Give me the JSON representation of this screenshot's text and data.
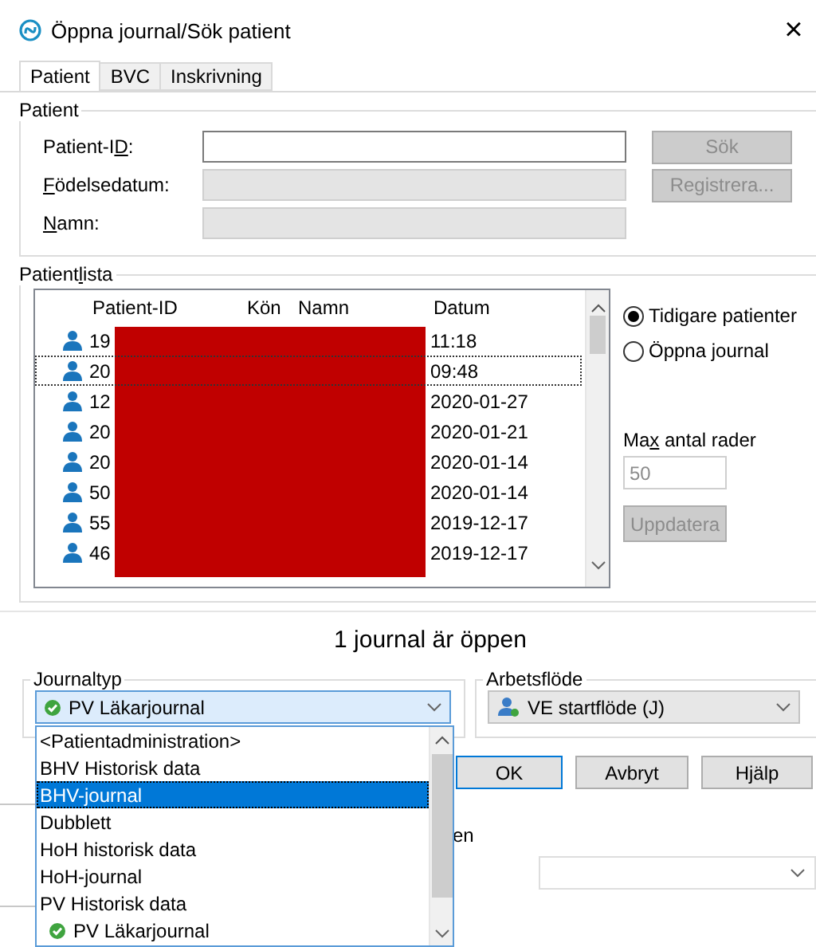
{
  "window": {
    "title": "Öppna journal/Sök patient",
    "close": "×"
  },
  "tabs": [
    {
      "label": "Patient",
      "selected": true
    },
    {
      "label": "BVC",
      "selected": false
    },
    {
      "label": "Inskrivning",
      "selected": false
    }
  ],
  "patient_group": {
    "legend": "Patient",
    "fields": [
      {
        "label": {
          "before": "Patient-I",
          "key": "D",
          "after": ":"
        },
        "disabled": false
      },
      {
        "label": {
          "key": "F",
          "after": "ödelsedatum:"
        },
        "disabled": true
      },
      {
        "label": {
          "key": "N",
          "after": "amn:"
        },
        "disabled": true
      }
    ],
    "buttons": [
      {
        "label": "Sök",
        "disabled": true
      },
      {
        "label": "Registrera...",
        "disabled": true
      }
    ]
  },
  "patient_list": {
    "legend": {
      "before": "Patient",
      "key": "l",
      "after": "ista"
    },
    "columns": [
      "Patient-ID",
      "Kön",
      "Namn",
      "Datum"
    ],
    "rows": [
      {
        "patient_id": "19",
        "datum": "11:18",
        "focused": false
      },
      {
        "patient_id": "20",
        "datum": "09:48",
        "focused": true
      },
      {
        "patient_id": "12",
        "datum": "2020-01-27",
        "focused": false
      },
      {
        "patient_id": "20",
        "datum": "2020-01-21",
        "focused": false
      },
      {
        "patient_id": "20",
        "datum": "2020-01-14",
        "focused": false
      },
      {
        "patient_id": "50",
        "datum": "2020-01-14",
        "focused": false
      },
      {
        "patient_id": "55",
        "datum": "2019-12-17",
        "focused": false
      },
      {
        "patient_id": "46",
        "datum": "2019-12-17",
        "focused": false
      }
    ],
    "redacted": true,
    "options": [
      {
        "label": "Tidigare patienter",
        "selected": true
      },
      {
        "label": "Öppna journal",
        "selected": false
      }
    ],
    "max_rows": {
      "label": {
        "before": "Ma",
        "key": "x",
        "after": " antal rader"
      },
      "value": "50"
    },
    "update_button": {
      "label": "Uppdatera",
      "disabled": true
    }
  },
  "status": "1 journal är öppen",
  "journaltyp": {
    "legend": "Journaltyp",
    "value": "PV Läkarjournal",
    "open": true,
    "items": [
      {
        "label": "<Patientadministration>",
        "highlighted": false,
        "selected": false
      },
      {
        "label": "BHV Historisk data",
        "highlighted": false,
        "selected": false
      },
      {
        "label": "BHV-journal",
        "highlighted": true,
        "selected": false
      },
      {
        "label": "Dubblett",
        "highlighted": false,
        "selected": false
      },
      {
        "label": "HoH historisk data",
        "highlighted": false,
        "selected": false
      },
      {
        "label": "HoH-journal",
        "highlighted": false,
        "selected": false
      },
      {
        "label": "PV Historisk data",
        "highlighted": false,
        "selected": false
      },
      {
        "label": "PV Läkarjournal",
        "highlighted": false,
        "selected": true
      }
    ]
  },
  "arbetsflode": {
    "legend": "Arbetsflöde",
    "value": "VE startflöde (J)"
  },
  "buttons": [
    {
      "label": "OK",
      "default": true
    },
    {
      "label": "Avbryt",
      "default": false
    },
    {
      "label": "Hjälp",
      "default": false
    }
  ],
  "hidden_label_tail": "en"
}
